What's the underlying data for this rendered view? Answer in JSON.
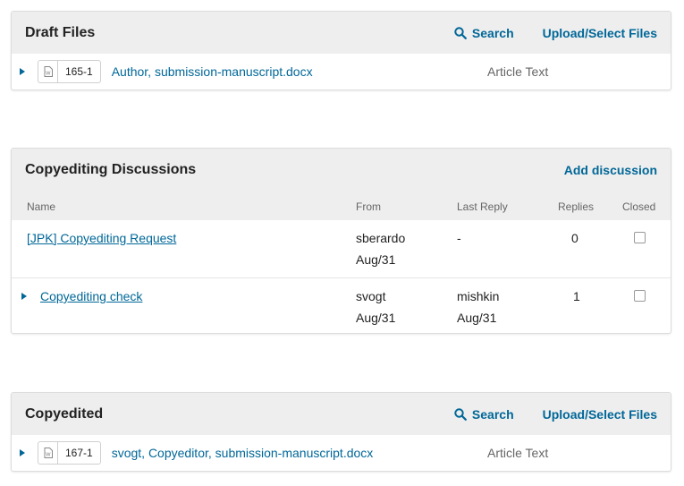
{
  "draft_files": {
    "title": "Draft Files",
    "search_label": "Search",
    "upload_label": "Upload/Select Files",
    "files": [
      {
        "id": "165-1",
        "name": "Author, submission-manuscript.docx",
        "genre": "Article Text"
      }
    ]
  },
  "copyediting_discussions": {
    "title": "Copyediting Discussions",
    "add_label": "Add discussion",
    "columns": {
      "name": "Name",
      "from": "From",
      "last_reply": "Last Reply",
      "replies": "Replies",
      "closed": "Closed"
    },
    "rows": [
      {
        "name": "[JPK] Copyediting Request",
        "from_user": "sberardo",
        "from_date": "Aug/31",
        "last_user": "-",
        "last_date": "",
        "replies": "0"
      },
      {
        "name": "Copyediting check",
        "from_user": "svogt",
        "from_date": "Aug/31",
        "last_user": "mishkin",
        "last_date": "Aug/31",
        "replies": "1"
      }
    ]
  },
  "copyedited": {
    "title": "Copyedited",
    "search_label": "Search",
    "upload_label": "Upload/Select Files",
    "files": [
      {
        "id": "167-1",
        "name": "svogt, Copyeditor, submission-manuscript.docx",
        "genre": "Article Text"
      }
    ]
  },
  "colors": {
    "link": "#006798",
    "header_bg": "#eeeeee"
  }
}
